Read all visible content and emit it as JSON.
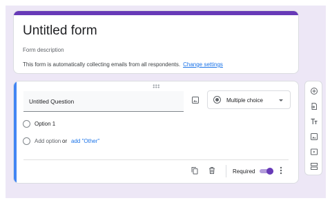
{
  "form": {
    "title": "Untitled form",
    "description_placeholder": "Form description",
    "email_note": "This form is automatically collecting emails from all respondents.",
    "change_settings_link": "Change settings",
    "accent_color": "#673ab7"
  },
  "question": {
    "title": "Untitled Question",
    "type": "Multiple choice",
    "options": [
      "Option 1"
    ],
    "add_option": "Add option",
    "or_text": "or",
    "add_other": "add \"Other\"",
    "required_label": "Required",
    "required_on": true
  },
  "icons": {
    "type_select": "radio-button-icon",
    "image": "image-icon",
    "duplicate": "copy-icon",
    "delete": "trash-icon",
    "more": "more-vert-icon"
  },
  "toolbar": {
    "items": [
      "add-question-icon",
      "import-questions-icon",
      "add-title-icon",
      "add-image-icon",
      "add-video-icon",
      "add-section-icon"
    ]
  }
}
